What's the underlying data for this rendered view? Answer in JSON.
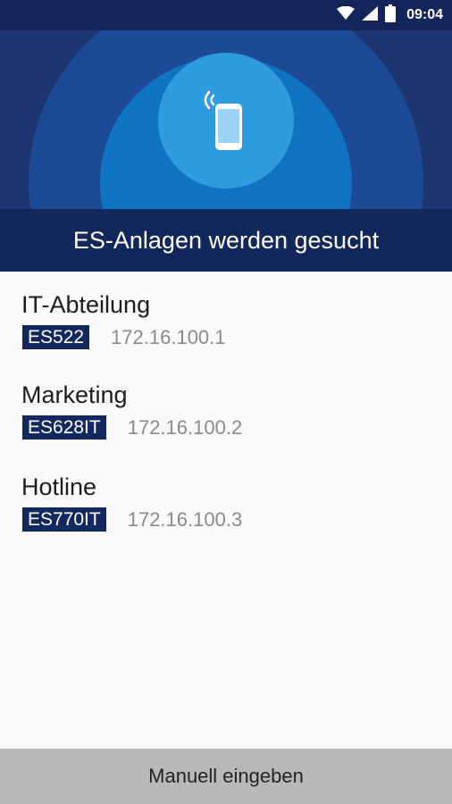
{
  "status_bar": {
    "time": "09:04",
    "icons": [
      "wifi-icon",
      "signal-icon",
      "battery-icon"
    ]
  },
  "header": {
    "title": "ES-Anlagen werden gesucht",
    "icon": "phone-broadcast-icon"
  },
  "devices": [
    {
      "name": "IT-Abteilung",
      "model": "ES522",
      "ip": "172.16.100.1"
    },
    {
      "name": "Marketing",
      "model": "ES628IT",
      "ip": "172.16.100.2"
    },
    {
      "name": "Hotline",
      "model": "ES770IT",
      "ip": "172.16.100.3"
    }
  ],
  "footer": {
    "button_label": "Manuell eingeben"
  },
  "colors": {
    "primary_dark": "#13255b",
    "badge_bg": "#13285e",
    "accent_blue": "#0e74c3",
    "footer_bg": "#b8b8b8"
  }
}
